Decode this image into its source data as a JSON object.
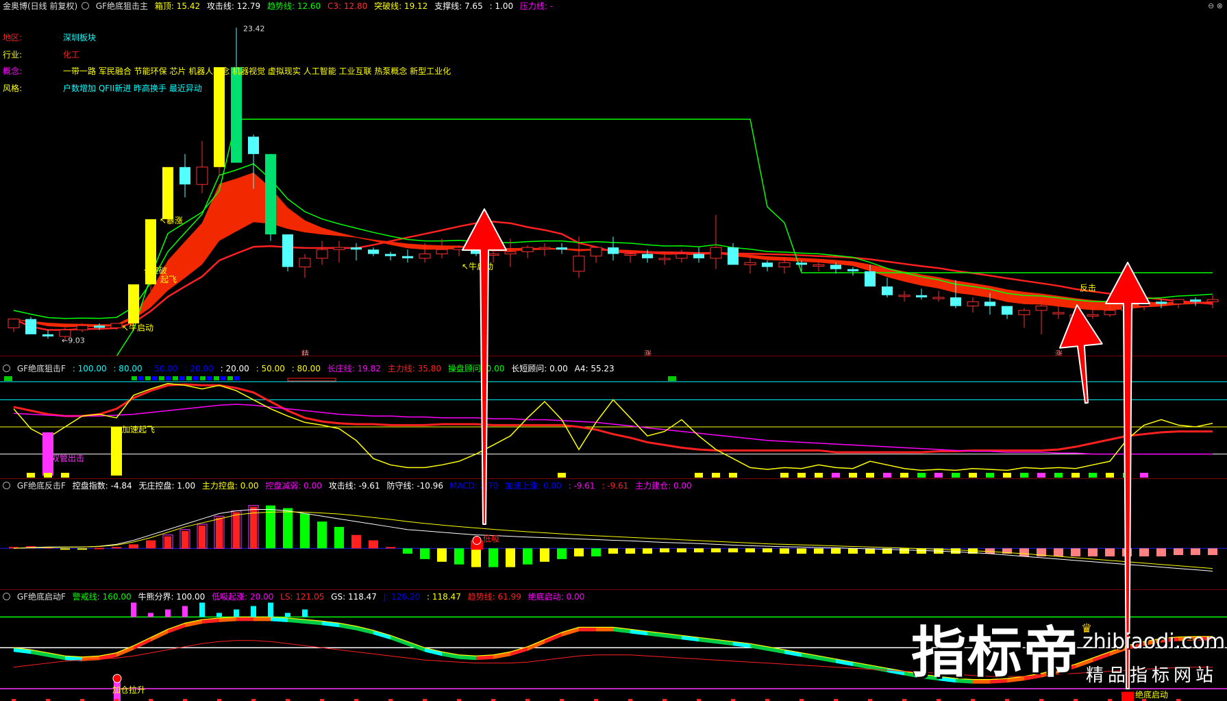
{
  "main": {
    "stock": "金奥博(日线 前复权)",
    "indicator": "GF绝底狙击主",
    "legend": [
      {
        "label": "箱顶: 15.42",
        "color": "#ffff00"
      },
      {
        "label": "攻击线: 12.79",
        "color": "#ffffff"
      },
      {
        "label": "趋势线: 12.60",
        "color": "#00ff00"
      },
      {
        "label": "C3: 12.80",
        "color": "#ff3030"
      },
      {
        "label": "突破线: 19.12",
        "color": "#ffff00"
      },
      {
        "label": "支撑线: 7.65",
        "color": "#ffffff"
      },
      {
        "label": ": 1.00",
        "color": "#ffffff"
      },
      {
        "label": "压力线: -",
        "color": "#ff00ff"
      }
    ],
    "info": [
      {
        "key": "地区:",
        "value": "深圳板块",
        "vcolor": "#00ffff"
      },
      {
        "key": "行业:",
        "value": "化工",
        "vcolor": "#ff2020"
      },
      {
        "key": "概念:",
        "value": "一带一路 军民融合 节能环保 芯片 机器人概念 机器视觉 虚拟现实 人工智能 工业互联 热泵概念 新型工业化",
        "vcolor": "#ffff00"
      },
      {
        "key": "风格:",
        "value": "户数增加 QFII新进 昨高换手 最近异动",
        "vcolor": "#00ffff"
      }
    ],
    "labels": {
      "high": "23.42",
      "low": "9.03",
      "niu1": "牛启动",
      "baozhang": "暴涨",
      "tupo": "突破",
      "qifei": "起飞",
      "niu2": "牛启动",
      "fanji": "反击",
      "mark1": "精",
      "mark2": "涨",
      "mark3": "涨"
    }
  },
  "pane2": {
    "indicator": "GF绝底狙击F",
    "legend": [
      {
        "label": ": 100.00",
        "color": "#00ffff"
      },
      {
        "label": ": 80.00",
        "color": "#00ffff"
      },
      {
        "label": ": 50.00",
        "color": "#0000ff"
      },
      {
        "label": ": 20.00",
        "color": "#0000ff"
      },
      {
        "label": ": 20.00",
        "color": "#ffffff"
      },
      {
        "label": ": 50.00",
        "color": "#ffff00"
      },
      {
        "label": ": 80.00",
        "color": "#ffff00"
      },
      {
        "label": "长庄线: 19.82",
        "color": "#ff00ff"
      },
      {
        "label": "主力线: 35.80",
        "color": "#ff2020"
      },
      {
        "label": "操盘顾问: 0.00",
        "color": "#00ff00"
      },
      {
        "label": "长短顾问: 0.00",
        "color": "#ffffff"
      },
      {
        "label": "A4: 55.23",
        "color": "#ffffff"
      }
    ],
    "labels": {
      "a": "双管出击",
      "b": "加速起飞"
    }
  },
  "pane3": {
    "indicator": "GF绝底反击F",
    "legend": [
      {
        "label": "控盘指数: -4.84",
        "color": "#ffffff"
      },
      {
        "label": "无庄控盘: 1.00",
        "color": "#ffffff"
      },
      {
        "label": "主力控盘: 0.00",
        "color": "#ffff00"
      },
      {
        "label": "控盘减弱: 0.00",
        "color": "#ff00ff"
      },
      {
        "label": "攻击线: -9.61",
        "color": "#ffffff"
      },
      {
        "label": "防守线: -10.96",
        "color": "#ffffff"
      },
      {
        "label": "MACD: 2.70",
        "color": "#0000ff"
      },
      {
        "label": "加速上涨: 0.00",
        "color": "#0000ff"
      },
      {
        "label": ": -9.61",
        "color": "#ff00ff"
      },
      {
        "label": ": -9.61",
        "color": "#ff2020"
      },
      {
        "label": "主力建仓: 0.00",
        "color": "#ff00ff"
      }
    ],
    "labels": {
      "a": "低吸"
    }
  },
  "pane4": {
    "indicator": "GF绝底启动F",
    "legend": [
      {
        "label": "警戒线: 160.00",
        "color": "#00ff00"
      },
      {
        "label": "牛熊分界: 100.00",
        "color": "#ffffff"
      },
      {
        "label": "低吸起涨: 20.00",
        "color": "#ff00ff"
      },
      {
        "label": "LS: 121.05",
        "color": "#ff2020"
      },
      {
        "label": "GS: 118.47",
        "color": "#ffffff"
      },
      {
        "label": "J: 126.20",
        "color": "#0000ff"
      },
      {
        "label": ": 118.47",
        "color": "#ffff00"
      },
      {
        "label": "趋势线: 61.99",
        "color": "#ff2020"
      },
      {
        "label": "绝底启动: 0.00",
        "color": "#ff00ff"
      }
    ],
    "labels": {
      "a": "加仓拉升",
      "b": "绝底启动"
    }
  },
  "watermark": {
    "big": "指标帝",
    "site": "zhibiaodi.com",
    "sub": "精品指标网站"
  },
  "chart_data": [
    {
      "type": "candlestick",
      "title": "金奥博(日线 前复权)",
      "x_index": [
        0,
        1,
        2,
        3,
        4,
        5,
        6,
        7,
        8,
        9,
        10,
        11,
        12,
        13,
        14,
        15,
        16,
        17,
        18,
        19,
        20,
        21,
        22,
        23,
        24,
        25,
        26,
        27,
        28,
        29,
        30,
        31,
        32,
        33,
        34,
        35,
        36,
        37,
        38,
        39,
        40,
        41,
        42,
        43,
        44,
        45,
        46,
        47,
        48,
        49,
        50,
        51,
        52,
        53,
        54,
        55,
        56,
        57,
        58,
        59,
        60,
        61,
        62,
        63,
        64,
        65,
        66,
        67,
        68,
        69,
        70
      ],
      "open": [
        9.6,
        10.0,
        9.3,
        9.2,
        9.5,
        9.7,
        9.6,
        9.8,
        11.6,
        14.6,
        17.0,
        16.2,
        17.0,
        21.6,
        18.4,
        17.6,
        13.9,
        12.4,
        12.8,
        13.2,
        13.3,
        13.2,
        13.0,
        12.9,
        12.8,
        13.0,
        13.2,
        13.3,
        13.0,
        13.0,
        13.1,
        13.3,
        13.3,
        12.2,
        12.9,
        13.3,
        13.0,
        13.0,
        12.8,
        12.8,
        13.0,
        12.8,
        13.3,
        12.5,
        12.6,
        12.4,
        12.6,
        12.5,
        12.5,
        12.3,
        12.2,
        11.5,
        11.1,
        11.1,
        11.0,
        11.0,
        10.6,
        10.8,
        10.6,
        10.2,
        10.4,
        10.3,
        10.0,
        10.2,
        10.2,
        10.4,
        10.6,
        10.8,
        10.7,
        10.9,
        10.8
      ],
      "high": [
        9.8,
        10.1,
        9.5,
        9.6,
        9.8,
        9.8,
        9.8,
        11.6,
        14.6,
        17.0,
        17.6,
        18.2,
        19.4,
        23.42,
        18.5,
        17.6,
        13.9,
        13.0,
        13.6,
        13.6,
        13.5,
        13.3,
        13.1,
        13.2,
        13.5,
        13.7,
        13.4,
        13.4,
        13.3,
        13.7,
        13.4,
        13.5,
        13.5,
        13.8,
        13.2,
        13.8,
        13.1,
        13.2,
        13.0,
        13.2,
        13.3,
        14.8,
        13.5,
        12.9,
        12.7,
        12.8,
        12.7,
        12.6,
        12.6,
        12.4,
        12.5,
        11.9,
        11.3,
        11.4,
        11.3,
        11.8,
        11.0,
        11.2,
        10.6,
        10.5,
        10.9,
        10.6,
        10.4,
        10.6,
        10.8,
        11.0,
        10.8,
        10.9,
        10.8,
        11.0,
        11.1
      ],
      "low": [
        9.4,
        9.4,
        9.1,
        9.03,
        9.4,
        9.5,
        9.5,
        9.7,
        11.3,
        14.4,
        15.6,
        15.8,
        16.6,
        17.8,
        16.0,
        13.6,
        12.2,
        11.9,
        12.5,
        12.6,
        12.7,
        12.9,
        12.7,
        12.6,
        12.6,
        12.8,
        12.9,
        12.9,
        12.6,
        12.4,
        12.8,
        12.9,
        13.0,
        11.9,
        12.6,
        12.7,
        12.6,
        12.6,
        12.5,
        12.6,
        12.6,
        12.3,
        12.5,
        12.1,
        12.2,
        12.1,
        12.2,
        12.2,
        12.1,
        12.0,
        11.8,
        11.0,
        10.8,
        10.9,
        10.8,
        10.5,
        10.3,
        10.2,
        10.0,
        9.6,
        9.3,
        10.0,
        9.8,
        10.0,
        10.1,
        10.3,
        10.4,
        10.5,
        10.5,
        10.6,
        10.5
      ],
      "close": [
        10.0,
        9.3,
        9.2,
        9.5,
        9.7,
        9.6,
        9.8,
        11.6,
        14.6,
        17.0,
        16.2,
        17.0,
        21.6,
        17.2,
        17.6,
        13.9,
        12.4,
        12.8,
        13.2,
        13.3,
        13.2,
        13.0,
        12.9,
        12.8,
        13.0,
        13.2,
        13.3,
        13.0,
        13.0,
        13.1,
        13.3,
        13.3,
        13.2,
        12.9,
        13.3,
        13.0,
        13.0,
        12.8,
        12.8,
        13.0,
        12.8,
        13.3,
        12.5,
        12.6,
        12.4,
        12.6,
        12.5,
        12.5,
        12.3,
        12.2,
        11.5,
        11.1,
        11.1,
        11.0,
        11.0,
        10.6,
        10.8,
        10.6,
        10.2,
        10.4,
        10.6,
        10.3,
        10.2,
        10.2,
        10.4,
        10.6,
        10.8,
        10.7,
        10.9,
        10.8,
        10.9
      ],
      "ylim": [
        8.6,
        24.0
      ]
    },
    {
      "type": "line",
      "title": "GF绝底狙击F",
      "ylim": [
        0,
        100
      ],
      "hlines": [
        100,
        80,
        50,
        20
      ],
      "series": [
        {
          "name": "主力线",
          "color": "#ff2020",
          "values": [
            72,
            68,
            64,
            62,
            62,
            64,
            70,
            82,
            90,
            96,
            97,
            96,
            96,
            93,
            88,
            78,
            68,
            60,
            56,
            54,
            53,
            53,
            52,
            52,
            52,
            53,
            53,
            53,
            52,
            52,
            52,
            52,
            52,
            50,
            47,
            42,
            38,
            33,
            30,
            27,
            25,
            24,
            24,
            24,
            24,
            24,
            24,
            24,
            22,
            22,
            22,
            22,
            22,
            22,
            23,
            23,
            24,
            24,
            24,
            24,
            24,
            25,
            28,
            32,
            36,
            40,
            42,
            44,
            45,
            45,
            45
          ]
        },
        {
          "name": "长庄线",
          "color": "#ff00ff",
          "values": [
            65,
            64,
            63,
            62,
            62,
            62,
            63,
            64,
            66,
            68,
            70,
            72,
            74,
            75,
            74,
            72,
            70,
            68,
            66,
            64,
            63,
            62,
            62,
            61,
            61,
            60,
            60,
            60,
            59,
            59,
            58,
            58,
            57,
            56,
            55,
            53,
            51,
            49,
            47,
            45,
            43,
            41,
            39,
            37,
            35,
            34,
            33,
            32,
            31,
            30,
            29,
            28,
            27,
            26,
            25,
            24,
            23,
            23,
            22,
            22,
            22,
            21,
            21,
            20,
            20,
            20,
            20,
            20,
            20,
            20,
            20
          ]
        },
        {
          "name": "A4",
          "color": "#ffff00",
          "values": [
            70,
            48,
            38,
            50,
            62,
            64,
            60,
            85,
            92,
            98,
            96,
            92,
            96,
            90,
            80,
            70,
            62,
            55,
            52,
            48,
            35,
            15,
            8,
            5,
            5,
            8,
            12,
            20,
            30,
            40,
            60,
            78,
            58,
            25,
            55,
            80,
            60,
            40,
            45,
            58,
            40,
            25,
            15,
            5,
            3,
            5,
            4,
            8,
            5,
            4,
            12,
            8,
            4,
            2,
            3,
            2,
            4,
            3,
            2,
            5,
            4,
            5,
            4,
            8,
            12,
            36,
            52,
            58,
            52,
            50,
            54
          ]
        }
      ]
    },
    {
      "type": "bar",
      "title": "GF绝底反击F",
      "ylim": [
        -14,
        20
      ],
      "values": [
        0.5,
        0.8,
        0.5,
        -0.3,
        -0.5,
        0.2,
        0.5,
        1.5,
        3,
        5,
        7,
        9,
        12,
        14,
        16,
        16,
        15,
        13,
        10,
        8,
        5,
        3,
        0.5,
        -2,
        -4,
        -5,
        -6,
        -7,
        -7,
        -7,
        -6,
        -5,
        -4,
        -3,
        -3,
        -2,
        -2,
        -2,
        -1.5,
        -1.5,
        -1.5,
        -1.5,
        -1.5,
        -1.5,
        -1.5,
        -2,
        -2,
        -2,
        -2,
        -2,
        -2,
        -2,
        -2,
        -2,
        -2,
        -2,
        -2,
        -2,
        -2,
        -3,
        -3,
        -3,
        -3,
        -3,
        -3,
        -3,
        -3,
        -3,
        -2.5,
        -2.5,
        -2.5
      ],
      "series": [
        {
          "name": "攻击线",
          "color": "#ffffff",
          "values": [
            0,
            0.3,
            0.5,
            0.5,
            0.5,
            0.8,
            1.5,
            3,
            5,
            7,
            9,
            11,
            13,
            14,
            14.5,
            14.5,
            14,
            13,
            12,
            11,
            10,
            9,
            8,
            7,
            6.5,
            6,
            5.5,
            5,
            4.8,
            4.5,
            4.2,
            4,
            3.8,
            3.5,
            3.3,
            3,
            2.8,
            2.5,
            2.2,
            2,
            1.8,
            1.5,
            1.2,
            1,
            0.8,
            0.6,
            0.5,
            0.3,
            0.2,
            0,
            -0.2,
            -0.4,
            -0.6,
            -0.8,
            -1,
            -1.3,
            -1.6,
            -2,
            -2.5,
            -3,
            -3.5,
            -4,
            -4.5,
            -5,
            -5.5,
            -6,
            -6.5,
            -7,
            -7.5,
            -8,
            -8.5
          ]
        },
        {
          "name": "防守线",
          "color": "#ffff00",
          "values": [
            0,
            0.2,
            0.3,
            0.4,
            0.5,
            0.7,
            1.2,
            2.4,
            4,
            6,
            8,
            9.5,
            11,
            12.5,
            13.2,
            13.5,
            13.6,
            13.5,
            13.2,
            12.8,
            12.2,
            11.5,
            10.8,
            10,
            9.3,
            8.7,
            8.1,
            7.6,
            7.1,
            6.6,
            6.2,
            5.8,
            5.4,
            5,
            4.7,
            4.4,
            4.1,
            3.8,
            3.5,
            3.2,
            2.9,
            2.6,
            2.3,
            2,
            1.7,
            1.5,
            1.3,
            1.1,
            0.9,
            0.7,
            0.5,
            0.3,
            0.1,
            -0.1,
            -0.3,
            -0.6,
            -0.9,
            -1.2,
            -1.6,
            -2,
            -2.5,
            -3,
            -3.5,
            -4,
            -4.5,
            -5,
            -5.5,
            -6,
            -6.5,
            -7,
            -7.5
          ]
        }
      ]
    },
    {
      "type": "area",
      "title": "GF绝底启动F",
      "ylim": [
        0,
        190
      ],
      "hlines": [
        160,
        100,
        20
      ],
      "series": [
        {
          "name": "GS",
          "color": "#ffffff",
          "values": [
            100,
            96,
            90,
            84,
            82,
            84,
            90,
            104,
            120,
            136,
            148,
            155,
            158,
            160,
            160,
            160,
            158,
            155,
            152,
            148,
            142,
            134,
            124,
            112,
            100,
            92,
            86,
            84,
            86,
            92,
            102,
            116,
            130,
            140,
            140,
            140,
            136,
            132,
            128,
            124,
            120,
            116,
            112,
            108,
            102,
            96,
            90,
            84,
            78,
            72,
            66,
            60,
            54,
            48,
            44,
            40,
            38,
            38,
            40,
            44,
            50,
            58,
            68,
            80,
            92,
            104,
            112,
            118,
            121,
            122,
            122
          ]
        },
        {
          "name": "趋势线",
          "color": "#ff2020",
          "values": [
            62,
            66,
            70,
            74,
            76,
            78,
            80,
            84,
            90,
            96,
            102,
            108,
            112,
            114,
            114,
            112,
            108,
            104,
            100,
            96,
            92,
            88,
            84,
            80,
            76,
            74,
            72,
            70,
            70,
            70,
            72,
            76,
            80,
            84,
            86,
            86,
            86,
            84,
            82,
            80,
            78,
            76,
            74,
            72,
            70,
            68,
            66,
            64,
            62,
            60,
            58,
            56,
            54,
            52,
            50,
            48,
            46,
            44,
            44,
            44,
            46,
            48,
            50,
            52,
            54,
            56,
            58,
            60,
            61,
            62,
            62
          ]
        }
      ]
    }
  ]
}
